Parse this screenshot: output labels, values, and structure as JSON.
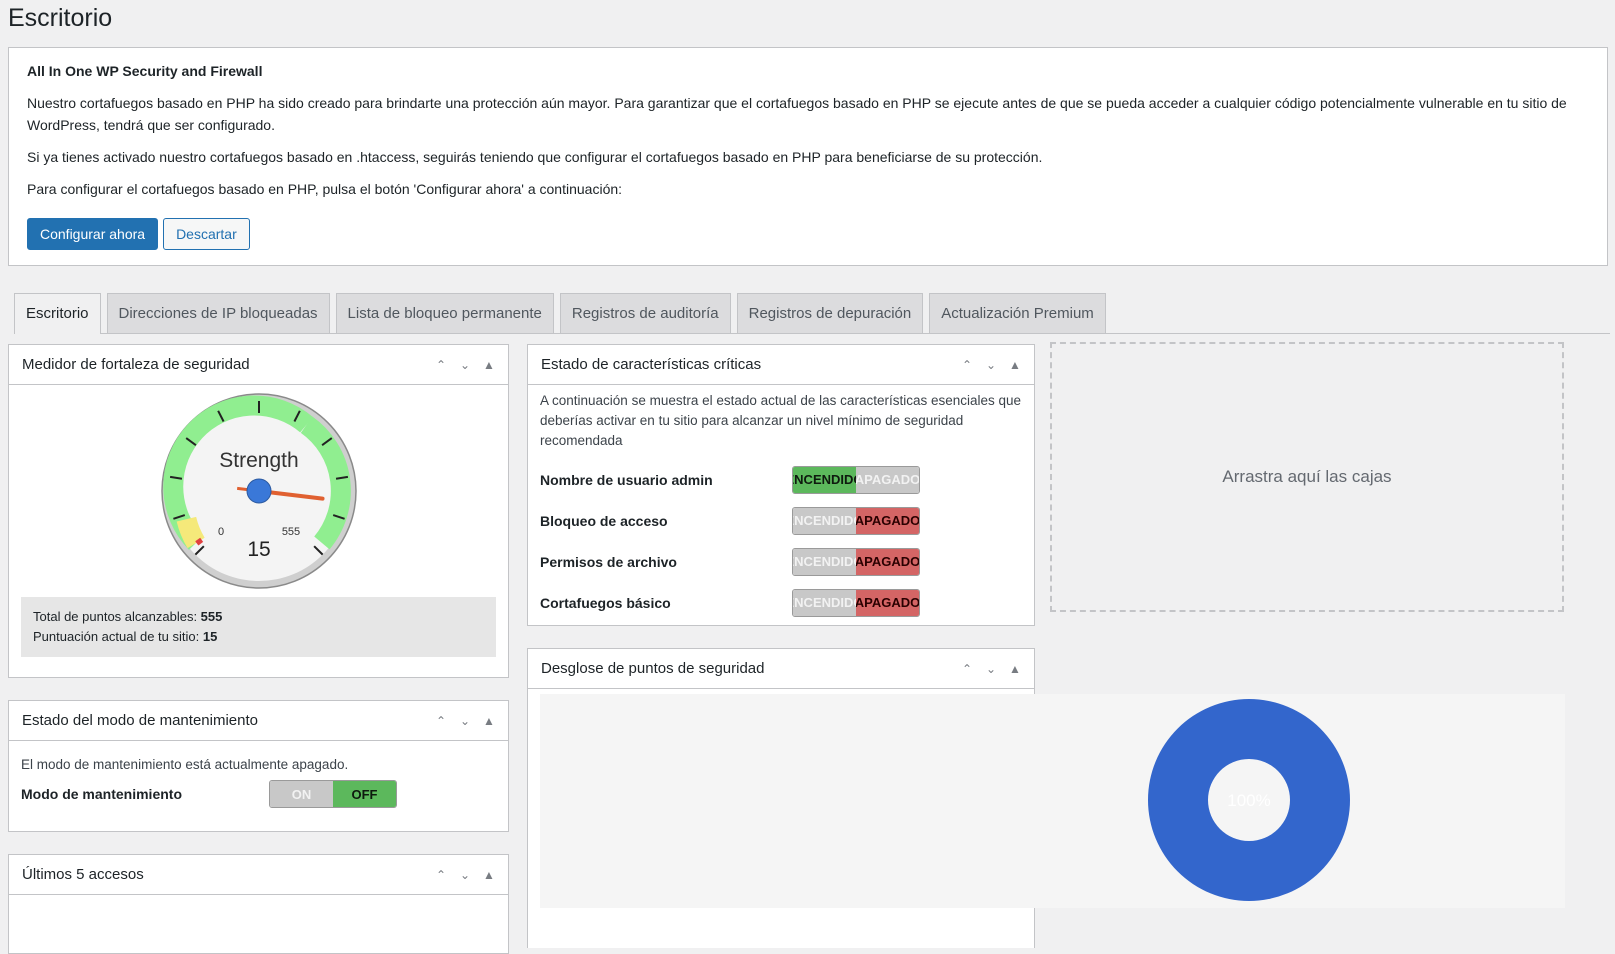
{
  "page": {
    "title": "Escritorio"
  },
  "notice": {
    "title": "All In One WP Security and Firewall",
    "p1": "Nuestro cortafuegos basado en PHP ha sido creado para brindarte una protección aún mayor. Para garantizar que el cortafuegos basado en PHP se ejecute antes de que se pueda acceder a cualquier código potencialmente vulnerable en tu sitio de WordPress, tendrá que ser configurado.",
    "p2": "Si ya tienes activado nuestro cortafuegos basado en .htaccess, seguirás teniendo que configurar el cortafuegos basado en PHP para beneficiarse de su protección.",
    "p3": "Para configurar el cortafuegos basado en PHP, pulsa el botón 'Configurar ahora' a continuación:",
    "configure_label": "Configurar ahora",
    "dismiss_label": "Descartar"
  },
  "tabs": [
    {
      "label": "Escritorio"
    },
    {
      "label": "Direcciones de IP bloqueadas"
    },
    {
      "label": "Lista de bloqueo permanente"
    },
    {
      "label": "Registros de auditoría"
    },
    {
      "label": "Registros de depuración"
    },
    {
      "label": "Actualización Premium"
    }
  ],
  "strength_meter": {
    "title": "Medidor de fortaleza de seguridad",
    "gauge_label": "Strength",
    "gauge_min": "0",
    "gauge_max": "555",
    "gauge_value": "15",
    "score_fraction": 0.027,
    "total_label": "Total de puntos alcanzables: ",
    "total_value": "555",
    "current_label": "Puntuación actual de tu sitio: ",
    "current_value": "15"
  },
  "maintenance": {
    "title": "Estado del modo de mantenimiento",
    "text": "El modo de mantenimiento está actualmente apagado.",
    "label": "Modo de mantenimiento",
    "on": "ON",
    "off": "OFF",
    "state": "off"
  },
  "last_logins": {
    "title": "Últimos 5 accesos"
  },
  "critical": {
    "title": "Estado de características críticas",
    "desc": "A continuación se muestra el estado actual de las características esenciales que deberías activar en tu sitio para alcanzar un nivel mínimo de seguridad recomendada",
    "on_label": "ENCENDIDO",
    "off_label": "APAGADO",
    "items": [
      {
        "label": "Nombre de usuario admin",
        "state": "on"
      },
      {
        "label": "Bloqueo de acceso",
        "state": "off"
      },
      {
        "label": "Permisos de archivo",
        "state": "off"
      },
      {
        "label": "Cortafuegos básico",
        "state": "off"
      }
    ]
  },
  "breakdown": {
    "title": "Desglose de puntos de seguridad",
    "donut_label": "100%",
    "color": "#3366cc"
  },
  "dropzone": {
    "text": "Arrastra aquí las cajas"
  },
  "chart_data": {
    "type": "pie",
    "title": "",
    "labels": [
      ""
    ],
    "values": [
      100
    ],
    "colors": [
      "#3366cc"
    ],
    "donut": true,
    "slice_labels": [
      "100%"
    ]
  }
}
